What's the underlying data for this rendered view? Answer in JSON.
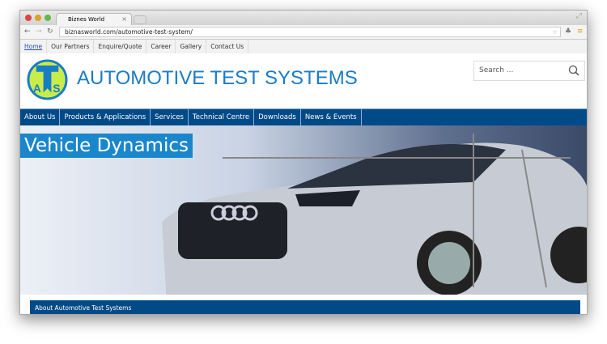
{
  "browser": {
    "tab_title": "Biznes World",
    "url": "biznasworld.com/automotive-test-system/"
  },
  "topnav": [
    "Home",
    "Our Partners",
    "Enquire/Quote",
    "Career",
    "Gallery",
    "Contact Us"
  ],
  "header": {
    "title": "AUTOMOTIVE TEST SYSTEMS",
    "logo_letters": "ATS",
    "search_placeholder": "Search ..."
  },
  "menu": [
    "About Us",
    "Products & Applications",
    "Services",
    "Technical Centre",
    "Downloads",
    "News & Events"
  ],
  "hero": {
    "title": "Vehicle Dynamics"
  },
  "content": {
    "heading": "About Automotive Test Systems"
  },
  "colors": {
    "brand": "#004a87",
    "accent": "#1a86cc"
  }
}
